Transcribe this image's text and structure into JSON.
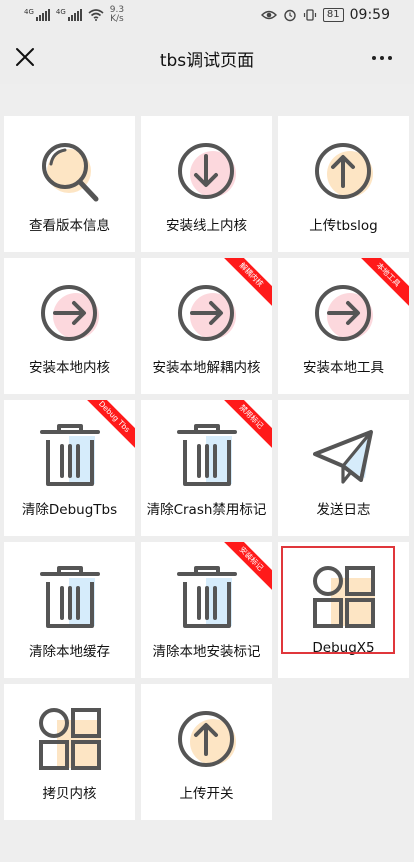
{
  "status_bar": {
    "signal1": "4G",
    "signal2": "4G",
    "speed_value": "9.3",
    "speed_unit": "K/s",
    "battery": "81",
    "time": "09:59"
  },
  "navbar": {
    "title": "tbs调试页面"
  },
  "tiles": [
    {
      "label": "查看版本信息",
      "icon": "search-icon",
      "accent": "#fde5c4",
      "ribbon": ""
    },
    {
      "label": "安装线上内核",
      "icon": "download-circle-icon",
      "accent": "#fcd8dd",
      "ribbon": ""
    },
    {
      "label": "上传tbslog",
      "icon": "upload-circle-icon",
      "accent": "#fde5c4",
      "ribbon": ""
    },
    {
      "label": "安装本地内核",
      "icon": "arrow-right-circle-icon",
      "accent": "#fcd8dd",
      "ribbon": ""
    },
    {
      "label": "安装本地解耦内核",
      "icon": "arrow-right-circle-icon",
      "accent": "#fcd8dd",
      "ribbon": "解耦内核"
    },
    {
      "label": "安装本地工具",
      "icon": "arrow-right-circle-icon",
      "accent": "#fcd8dd",
      "ribbon": "本地工具"
    },
    {
      "label": "清除DebugTbs",
      "icon": "trash-icon",
      "accent": "#d6ecfb",
      "ribbon": "Debug Tbs"
    },
    {
      "label": "清除Crash禁用标记",
      "icon": "trash-icon",
      "accent": "#d6ecfb",
      "ribbon": "禁用标记"
    },
    {
      "label": "发送日志",
      "icon": "paper-plane-icon",
      "accent": "#d6ecfb",
      "ribbon": ""
    },
    {
      "label": "清除本地缓存",
      "icon": "trash-icon",
      "accent": "#d6ecfb",
      "ribbon": ""
    },
    {
      "label": "清除本地安装标记",
      "icon": "trash-icon",
      "accent": "#d6ecfb",
      "ribbon": "安装标记"
    },
    {
      "label": "DebugX5",
      "icon": "grid-apps-icon",
      "accent": "#fde5c4",
      "ribbon": ""
    },
    {
      "label": "拷贝内核",
      "icon": "grid-apps-icon",
      "accent": "#fde5c4",
      "ribbon": ""
    },
    {
      "label": "上传开关",
      "icon": "upload-circle-icon",
      "accent": "#fde5c4",
      "ribbon": ""
    }
  ],
  "highlighted_tile": "DebugX5",
  "colors": {
    "ribbon": "#ff1a1a",
    "highlight_border": "#e0363b",
    "icon_stroke": "#555555",
    "background": "#eeeeee"
  }
}
